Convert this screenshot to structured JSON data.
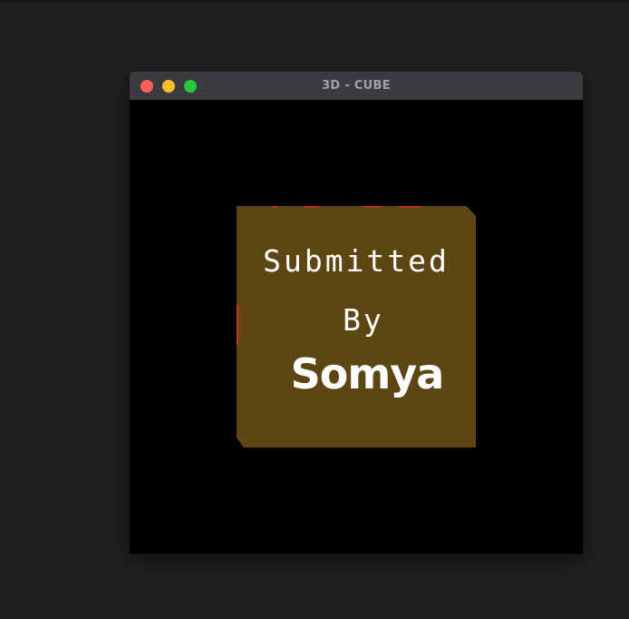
{
  "window": {
    "title": "3D - CUBE"
  },
  "cube": {
    "face_color": "#5d4614",
    "text_color": "#ffffff",
    "line1": "Submitted",
    "line2": "By",
    "line3": "Somya"
  },
  "colors": {
    "desktop_background": "#202020",
    "titlebar": "#3b3c40",
    "canvas_background": "#000000",
    "close": "#fe5f57",
    "minimize": "#febc2e",
    "maximize": "#28c840",
    "edge_accent": "#b5371f"
  }
}
